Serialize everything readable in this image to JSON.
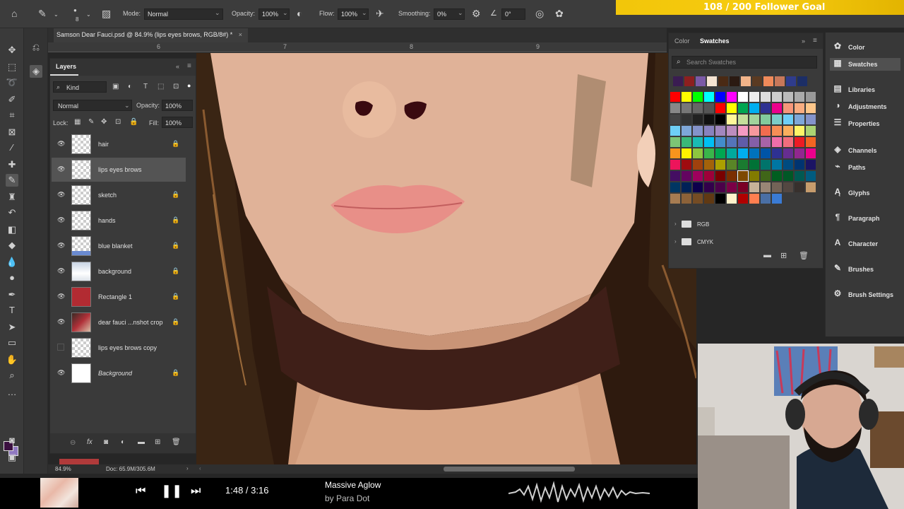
{
  "options_bar": {
    "mode_label": "Mode:",
    "mode_value": "Normal",
    "opacity_label": "Opacity:",
    "opacity_value": "100%",
    "flow_label": "Flow:",
    "flow_value": "100%",
    "smoothing_label": "Smoothing:",
    "smoothing_value": "0%",
    "angle_value": "0°",
    "brush_size": "8"
  },
  "follower_goal": "108 / 200 Follower Goal",
  "document": {
    "tab_title": "Samson Dear Fauci.psd @ 84.9% (lips eyes brows, RGB/8#) *",
    "ruler_numbers": [
      "6",
      "7",
      "8",
      "9"
    ]
  },
  "layers_panel": {
    "title": "Layers",
    "filter_kind": "Kind",
    "blend_mode": "Normal",
    "opacity_label": "Opacity:",
    "opacity_value": "100%",
    "lock_label": "Lock:",
    "fill_label": "Fill:",
    "fill_value": "100%",
    "layers": [
      {
        "name": "hair",
        "visible": true,
        "locked": true
      },
      {
        "name": "lips eyes brows",
        "visible": true,
        "locked": false,
        "selected": true
      },
      {
        "name": "sketch",
        "visible": true,
        "locked": true
      },
      {
        "name": "hands",
        "visible": true,
        "locked": true
      },
      {
        "name": "blue blanket",
        "visible": true,
        "locked": true
      },
      {
        "name": "background",
        "visible": true,
        "locked": true
      },
      {
        "name": "Rectangle 1",
        "visible": true,
        "locked": true
      },
      {
        "name": "dear fauci ...nshot crop",
        "visible": true,
        "locked": true
      },
      {
        "name": "lips eyes brows copy",
        "visible": false,
        "locked": false
      },
      {
        "name": "Background",
        "visible": true,
        "locked": true
      }
    ]
  },
  "swatches_panel": {
    "tab_color": "Color",
    "tab_swatches": "Swatches",
    "search_placeholder": "Search Swatches",
    "groups": [
      "RGB",
      "CMYK"
    ],
    "recent": [
      "#3a1c52",
      "#8c1f1f",
      "#7b5aa6",
      "#f5e4d2",
      "#4a2a14",
      "#2b1a12",
      "#f2b48a",
      "#5a3a22",
      "#f08a5a",
      "#c8785a",
      "#2f3c8c",
      "#1c2e66"
    ],
    "grid": [
      [
        "#ff0000",
        "#ffff00",
        "#00ff00",
        "#00ffff",
        "#0000ff",
        "#ff00ff",
        "#ffffff",
        "#eeeeee",
        "#dddddd",
        "#cccccc",
        "#bbbbbb",
        "#aaaaaa",
        "#999999"
      ],
      [
        "#888888",
        "#777777",
        "#666666",
        "#555555",
        "#ff0000",
        "#ffff00",
        "#00a651",
        "#00aeef",
        "#2e3192",
        "#ec008c",
        "#f7977a",
        "#f9ad81",
        "#fdc68a"
      ],
      [
        "#444444",
        "#333333",
        "#222222",
        "#111111",
        "#000000",
        "#fff79a",
        "#c4df9b",
        "#a2d39c",
        "#82ca9d",
        "#7bcdc8",
        "#6ecff6",
        "#7ea7d8",
        "#8493ca"
      ],
      [
        "#6ecff6",
        "#7ea7d8",
        "#8493ca",
        "#8882be",
        "#a187be",
        "#bc8dbf",
        "#f49ac2",
        "#f6989d",
        "#f26c4f",
        "#f68e56",
        "#fbaf5d",
        "#fff467",
        "#acd372"
      ],
      [
        "#7cc576",
        "#3bb878",
        "#1abbb4",
        "#00bff3",
        "#438ccb",
        "#5574b9",
        "#605ca8",
        "#855fa8",
        "#a763a8",
        "#f06ea9",
        "#f26d7d",
        "#ed1c24",
        "#f26522"
      ],
      [
        "#f7941d",
        "#fff200",
        "#8dc63f",
        "#39b54a",
        "#00a651",
        "#00a99d",
        "#00aeef",
        "#0072bc",
        "#0054a6",
        "#2e3192",
        "#662d91",
        "#92278f",
        "#ec008c"
      ],
      [
        "#ed145b",
        "#9e0b0f",
        "#a0410d",
        "#a3620a",
        "#aba000",
        "#598527",
        "#1a7b30",
        "#007236",
        "#00746b",
        "#0076a3",
        "#004b80",
        "#003471",
        "#1b1464"
      ],
      [
        "#440e62",
        "#630460",
        "#9e005d",
        "#9e0039",
        "#790000",
        "#7b2e00",
        "#7d4900",
        "#827b00",
        "#406618",
        "#005e20",
        "#005826",
        "#005952",
        "#005b7f"
      ],
      [
        "#003663",
        "#002157",
        "#0d004c",
        "#32004b",
        "#4b0049",
        "#7b0046",
        "#7a0026",
        "#c7b299",
        "#998675",
        "#736357",
        "#534741",
        "#37302d",
        "#c69c6d"
      ],
      [
        "#a67c52",
        "#8c6239",
        "#754c24",
        "#603913",
        "#000000",
        "#fff2cc",
        "#b00000",
        "#ff7f50",
        "#4a6fa5",
        "#3a7bd5"
      ]
    ]
  },
  "right_panel": {
    "items": [
      "Color",
      "Swatches",
      "Libraries",
      "Adjustments",
      "Properties",
      "Channels",
      "Paths",
      "Glyphs",
      "Paragraph",
      "Character",
      "Brushes",
      "Brush Settings"
    ],
    "icons": [
      "color-icon",
      "swatches-icon",
      "libraries-icon",
      "adjustments-icon",
      "properties-icon",
      "channels-icon",
      "paths-icon",
      "glyphs-icon",
      "paragraph-icon",
      "character-icon",
      "brushes-icon",
      "brush-settings-icon"
    ]
  },
  "status_bar": {
    "zoom": "84.9%",
    "doc_size": "Doc: 65.9M/305.6M"
  },
  "music_player": {
    "time": "1:48 / 3:16",
    "song_title": "Massive Aglow",
    "artist": "by Para Dot"
  },
  "colors": {
    "foreground": "#3b1040",
    "background": "#8f78c0",
    "goal_bar": "#f2c60a"
  }
}
